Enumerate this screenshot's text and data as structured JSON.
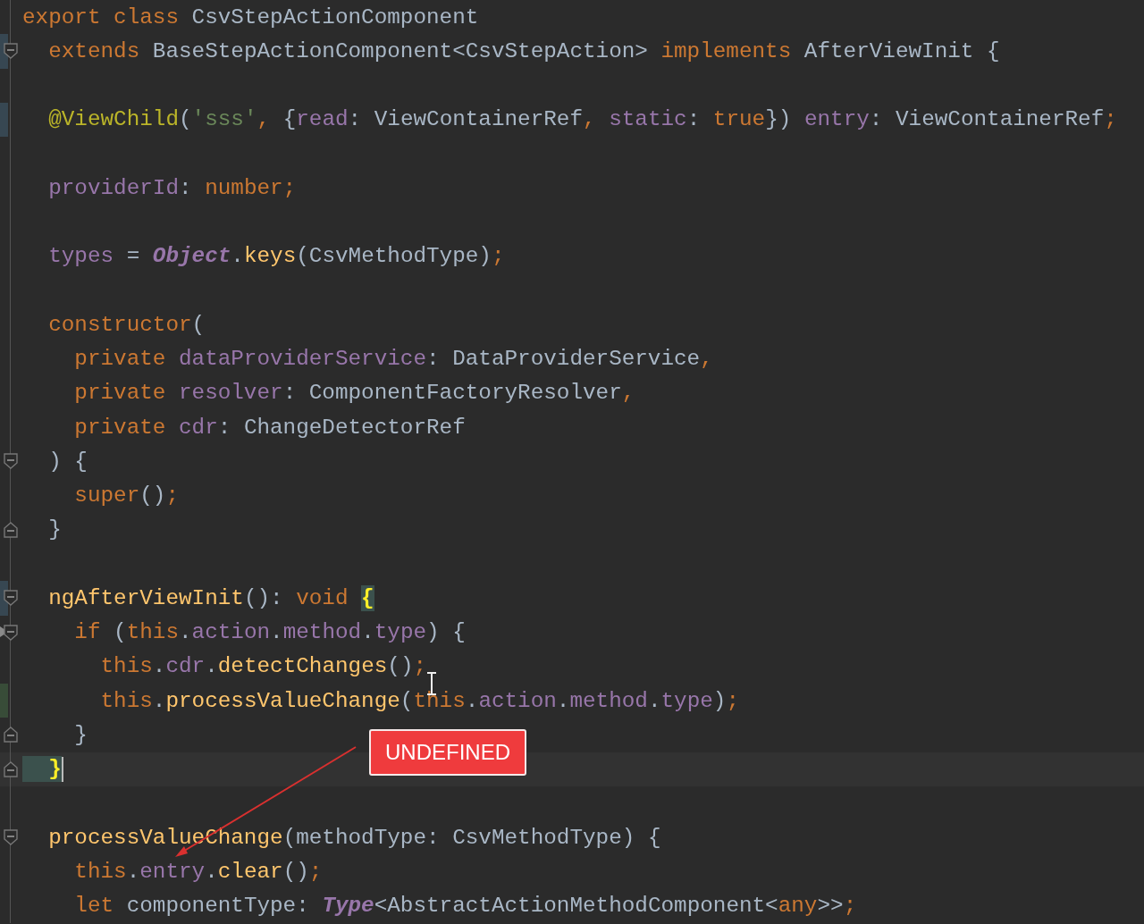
{
  "editor": {
    "lines": [
      {
        "tokens": [
          {
            "kind": "kw",
            "t": "export class "
          },
          {
            "kind": "plain",
            "t": "CsvStepActionComponent"
          }
        ]
      },
      {
        "fold_start": true,
        "changed": true,
        "tokens": [
          {
            "kind": "kw",
            "t": "  extends "
          },
          {
            "kind": "plain",
            "t": "BaseStepActionComponent<CsvStepAction> "
          },
          {
            "kind": "kw",
            "t": "implements "
          },
          {
            "kind": "plain",
            "t": "AfterViewInit {"
          }
        ]
      },
      {
        "space_before": true,
        "changed": true,
        "tokens": [
          {
            "kind": "ann",
            "t": "  @ViewChild"
          },
          {
            "kind": "plain",
            "t": "("
          },
          {
            "kind": "str",
            "t": "'sss'"
          },
          {
            "kind": "kw",
            "t": ", "
          },
          {
            "kind": "plain",
            "t": "{"
          },
          {
            "kind": "field",
            "t": "read"
          },
          {
            "kind": "plain",
            "t": ": ViewContainerRef"
          },
          {
            "kind": "kw",
            "t": ", "
          },
          {
            "kind": "field",
            "t": "static"
          },
          {
            "kind": "plain",
            "t": ": "
          },
          {
            "kind": "kw",
            "t": "true"
          },
          {
            "kind": "plain",
            "t": "}) "
          },
          {
            "kind": "field",
            "t": "entry"
          },
          {
            "kind": "plain",
            "t": ": ViewContainerRef"
          },
          {
            "kind": "kw",
            "t": ";"
          }
        ]
      },
      {
        "space_before": true,
        "tokens": [
          {
            "kind": "field",
            "t": "  providerId"
          },
          {
            "kind": "plain",
            "t": ": "
          },
          {
            "kind": "kw",
            "t": "number;"
          }
        ]
      },
      {
        "space_before": true,
        "tokens": [
          {
            "kind": "field",
            "t": "  types"
          },
          {
            "kind": "plain",
            "t": " = "
          },
          {
            "kind": "italic",
            "t": "Object"
          },
          {
            "kind": "plain",
            "t": "."
          },
          {
            "kind": "func",
            "t": "keys"
          },
          {
            "kind": "plain",
            "t": "(CsvMethodType)"
          },
          {
            "kind": "kw",
            "t": ";"
          }
        ]
      },
      {
        "space_before": true,
        "tokens": [
          {
            "kind": "kw",
            "t": "  constructor"
          },
          {
            "kind": "plain",
            "t": "("
          }
        ]
      },
      {
        "tokens": [
          {
            "kind": "kw",
            "t": "    private "
          },
          {
            "kind": "field",
            "t": "dataProviderService"
          },
          {
            "kind": "plain",
            "t": ": DataProviderService"
          },
          {
            "kind": "kw",
            "t": ","
          }
        ]
      },
      {
        "tokens": [
          {
            "kind": "kw",
            "t": "    private "
          },
          {
            "kind": "field",
            "t": "resolver"
          },
          {
            "kind": "plain",
            "t": ": ComponentFactoryResolver"
          },
          {
            "kind": "kw",
            "t": ","
          }
        ]
      },
      {
        "tokens": [
          {
            "kind": "kw",
            "t": "    private "
          },
          {
            "kind": "field",
            "t": "cdr"
          },
          {
            "kind": "plain",
            "t": ": ChangeDetectorRef"
          }
        ]
      },
      {
        "fold_start": true,
        "tokens": [
          {
            "kind": "plain",
            "t": "  ) {"
          }
        ]
      },
      {
        "tokens": [
          {
            "kind": "kw",
            "t": "    super"
          },
          {
            "kind": "plain",
            "t": "()"
          },
          {
            "kind": "kw",
            "t": ";"
          }
        ]
      },
      {
        "fold_end": true,
        "tokens": [
          {
            "kind": "plain",
            "t": "  }"
          }
        ]
      },
      {
        "space_before": true,
        "fold_start": true,
        "changed": true,
        "tokens": [
          {
            "kind": "func",
            "t": "  ngAfterViewInit"
          },
          {
            "kind": "plain",
            "t": "(): "
          },
          {
            "kind": "kw",
            "t": "void "
          },
          {
            "kind": "match",
            "t": "{"
          }
        ]
      },
      {
        "fold_start": true,
        "breakpoint": true,
        "tokens": [
          {
            "kind": "kw",
            "t": "    if "
          },
          {
            "kind": "plain",
            "t": "("
          },
          {
            "kind": "kw",
            "t": "this"
          },
          {
            "kind": "plain",
            "t": "."
          },
          {
            "kind": "field",
            "t": "action"
          },
          {
            "kind": "plain",
            "t": "."
          },
          {
            "kind": "field",
            "t": "method"
          },
          {
            "kind": "plain",
            "t": "."
          },
          {
            "kind": "field",
            "t": "type"
          },
          {
            "kind": "plain",
            "t": ") {"
          }
        ]
      },
      {
        "tokens": [
          {
            "kind": "kw",
            "t": "      this"
          },
          {
            "kind": "plain",
            "t": "."
          },
          {
            "kind": "field",
            "t": "cdr"
          },
          {
            "kind": "plain",
            "t": "."
          },
          {
            "kind": "func",
            "t": "detectChanges"
          },
          {
            "kind": "plain",
            "t": "()"
          },
          {
            "kind": "kw",
            "t": ";"
          }
        ]
      },
      {
        "added": true,
        "tokens": [
          {
            "kind": "kw",
            "t": "      this"
          },
          {
            "kind": "plain",
            "t": "."
          },
          {
            "kind": "func",
            "t": "processValueChange"
          },
          {
            "kind": "plain",
            "t": "("
          },
          {
            "kind": "kw",
            "t": "this"
          },
          {
            "kind": "plain",
            "t": "."
          },
          {
            "kind": "field",
            "t": "action"
          },
          {
            "kind": "plain",
            "t": "."
          },
          {
            "kind": "field",
            "t": "method"
          },
          {
            "kind": "plain",
            "t": "."
          },
          {
            "kind": "field",
            "t": "type"
          },
          {
            "kind": "plain",
            "t": ")"
          },
          {
            "kind": "kw",
            "t": ";"
          }
        ]
      },
      {
        "fold_end": true,
        "tokens": [
          {
            "kind": "plain",
            "t": "    }"
          }
        ]
      },
      {
        "fold_end": true,
        "current": true,
        "caret": true,
        "tokens": [
          {
            "kind": "match",
            "t": "  }"
          }
        ]
      },
      {
        "space_before": true,
        "fold_start": true,
        "tokens": [
          {
            "kind": "func",
            "t": "  processValueChange"
          },
          {
            "kind": "plain",
            "t": "(methodType: CsvMethodType) {"
          }
        ]
      },
      {
        "tokens": [
          {
            "kind": "kw",
            "t": "    this"
          },
          {
            "kind": "plain",
            "t": "."
          },
          {
            "kind": "field",
            "t": "entry"
          },
          {
            "kind": "plain",
            "t": "."
          },
          {
            "kind": "func",
            "t": "clear"
          },
          {
            "kind": "plain",
            "t": "()"
          },
          {
            "kind": "kw",
            "t": ";"
          }
        ]
      },
      {
        "tokens": [
          {
            "kind": "kw",
            "t": "    let "
          },
          {
            "kind": "plain",
            "t": "componentType: "
          },
          {
            "kind": "italic",
            "t": "Type"
          },
          {
            "kind": "plain",
            "t": "<AbstractActionMethodComponent<"
          },
          {
            "kind": "kw",
            "t": "any"
          },
          {
            "kind": "plain",
            "t": ">>"
          },
          {
            "kind": "kw",
            "t": ";"
          }
        ]
      }
    ]
  },
  "callout": {
    "label": "UNDEFINED"
  }
}
